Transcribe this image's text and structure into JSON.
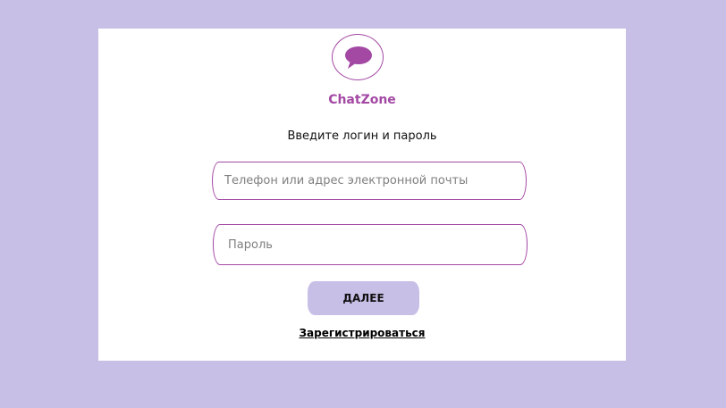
{
  "app": {
    "name": "ChatZone",
    "logo_icon": "speech-bubble-icon",
    "accent_color": "#a349a4",
    "background_color": "#c8bfe7"
  },
  "login_form": {
    "prompt": "Введите логин и пароль",
    "login_placeholder": "Телефон или адрес электронной почты",
    "login_value": "",
    "password_placeholder": "Пароль",
    "password_value": "",
    "submit_label": "ДАЛЕЕ",
    "register_link_label": "Зарегистрироваться"
  }
}
